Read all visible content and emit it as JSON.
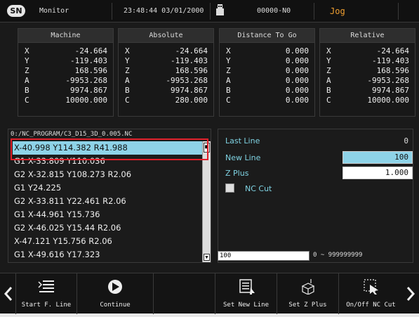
{
  "topbar": {
    "logo": "SN",
    "title": "Monitor",
    "datetime": "23:48:44 03/01/2000",
    "program_id": "00000-N0",
    "mode": "Jog"
  },
  "panels": [
    {
      "title": "Machine",
      "rows": [
        [
          "X",
          "-24.664"
        ],
        [
          "Y",
          "-119.403"
        ],
        [
          "Z",
          "168.596"
        ],
        [
          "A",
          "-9953.268"
        ],
        [
          "B",
          "9974.867"
        ],
        [
          "C",
          "10000.000"
        ]
      ]
    },
    {
      "title": "Absolute",
      "rows": [
        [
          "X",
          "-24.664"
        ],
        [
          "Y",
          "-119.403"
        ],
        [
          "Z",
          "168.596"
        ],
        [
          "A",
          "-9953.268"
        ],
        [
          "B",
          "9974.867"
        ],
        [
          "C",
          "280.000"
        ]
      ]
    },
    {
      "title": "Distance To Go",
      "rows": [
        [
          "X",
          "0.000"
        ],
        [
          "Y",
          "0.000"
        ],
        [
          "Z",
          "0.000"
        ],
        [
          "A",
          "0.000"
        ],
        [
          "B",
          "0.000"
        ],
        [
          "C",
          "0.000"
        ]
      ]
    },
    {
      "title": "Relative",
      "rows": [
        [
          "X",
          "-24.664"
        ],
        [
          "Y",
          "-119.403"
        ],
        [
          "Z",
          "168.596"
        ],
        [
          "A",
          "-9953.268"
        ],
        [
          "B",
          "9974.867"
        ],
        [
          "C",
          "10000.000"
        ]
      ]
    }
  ],
  "program": {
    "path": "0:/NC_PROGRAM/C3_D15_3D_0.005.NC",
    "lines": [
      "X-40.998 Y114.382 R41.988",
      "G1 X-33.809 Y110.036",
      "G2 X-32.815 Y108.273 R2.06",
      "G1 Y24.225",
      "G2 X-33.811 Y22.461 R2.06",
      "G1 X-44.961 Y15.736",
      "G2 X-46.025 Y15.44 R2.06",
      "X-47.121 Y15.756 R2.06",
      "G1 X-49.616 Y17.323"
    ],
    "selected_index": 0
  },
  "info": {
    "last_line_label": "Last Line",
    "last_line_value": "0",
    "new_line_label": "New Line",
    "new_line_value": "100",
    "z_plus_label": "Z Plus",
    "z_plus_value": "1.000",
    "nc_cut_label": "NC Cut",
    "range_input": "100",
    "range_hint": "0 ~ 999999999"
  },
  "buttons": [
    {
      "label": "Start F. Line",
      "icon": "list-start-icon"
    },
    {
      "label": "Continue",
      "icon": "play-circle-icon"
    },
    {
      "label": "",
      "icon": ""
    },
    {
      "label": "Set New Line",
      "icon": "set-line-icon"
    },
    {
      "label": "Set Z Plus",
      "icon": "z-plus-icon"
    },
    {
      "label": "On/Off NC Cut",
      "icon": "nc-cut-icon"
    }
  ],
  "colors": {
    "accent": "#7fd3e3",
    "selected_row": "#8ed3e8",
    "mode": "#f0a030",
    "highlight_box": "#e0202a"
  }
}
